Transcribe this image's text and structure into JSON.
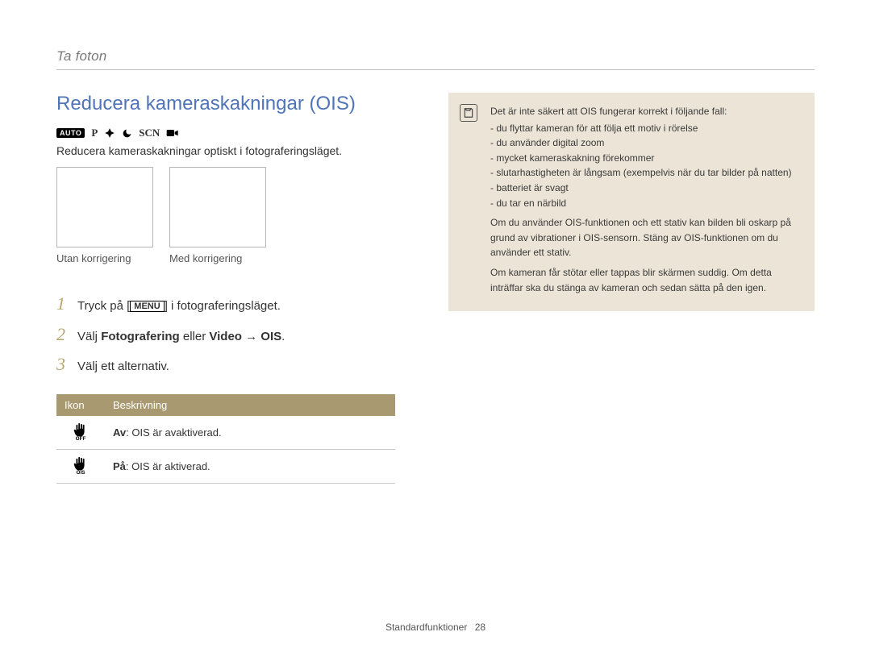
{
  "chapter": "Ta foton",
  "title": "Reducera kameraskakningar (OIS)",
  "modes": {
    "auto": "AUTO",
    "p": "P",
    "scn": "SCN"
  },
  "intro": "Reducera kameraskakningar optiskt i fotograferingsläget.",
  "thumbs": {
    "without": "Utan korrigering",
    "with": "Med korrigering"
  },
  "steps": [
    {
      "num": "1",
      "pre": "Tryck på [",
      "btn": "MENU",
      "post": "] i fotograferingsläget."
    },
    {
      "num": "2",
      "pre": "Välj ",
      "b1": "Fotografering",
      "mid": " eller ",
      "b2": "Video",
      "arrow": " → ",
      "b3": "OIS",
      "end": "."
    },
    {
      "num": "3",
      "text": "Välj ett alternativ."
    }
  ],
  "table": {
    "h1": "Ikon",
    "h2": "Beskrivning",
    "rows": [
      {
        "b": "Av",
        "d": ": OIS är avaktiverad."
      },
      {
        "b": "På",
        "d": ": OIS är aktiverad."
      }
    ]
  },
  "note": {
    "lead": "Det är inte säkert att OIS fungerar korrekt i följande fall:",
    "items": [
      "du flyttar kameran för att följa ett motiv i rörelse",
      "du använder digital zoom",
      "mycket kameraskakning förekommer",
      "slutarhastigheten är långsam (exempelvis när du tar bilder på natten)",
      "batteriet är svagt",
      "du tar en närbild"
    ],
    "p1": "Om du använder OIS-funktionen och ett stativ kan bilden bli oskarp på grund av vibrationer i OIS-sensorn. Stäng av OIS-funktionen om du använder ett stativ.",
    "p2": "Om kameran får stötar eller tappas blir skärmen suddig. Om detta inträffar ska du stänga av kameran och sedan sätta på den igen."
  },
  "footer": {
    "section": "Standardfunktioner",
    "page": "28"
  }
}
